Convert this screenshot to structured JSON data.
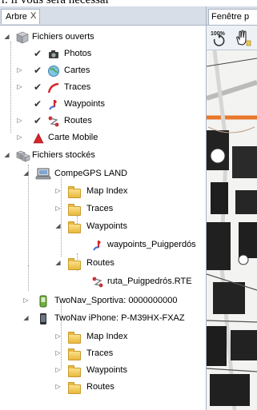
{
  "header_text": "r. il vous sera nécessai",
  "left_panel": {
    "tab_label": "Arbre",
    "tab_close": "X"
  },
  "tree": {
    "open_files": {
      "label": "Fichiers ouverts",
      "children": [
        {
          "label": "Photos",
          "icon": "camera-icon"
        },
        {
          "label": "Cartes",
          "icon": "globe-map-icon"
        },
        {
          "label": "Traces",
          "icon": "track-icon"
        },
        {
          "label": "Waypoints",
          "icon": "waypoint-icon"
        },
        {
          "label": "Routes",
          "icon": "route-icon"
        },
        {
          "label": "Carte Mobile",
          "icon": "red-triangle-icon"
        }
      ]
    },
    "stored_files": {
      "label": "Fichiers stockés",
      "compegps_land": {
        "label": "CompeGPS LAND",
        "map_index": "Map Index",
        "traces": "Traces",
        "waypoints": "Waypoints",
        "waypoints_file": "waypoints_Puigperdós",
        "routes": "Routes",
        "routes_file": "ruta_Puigpedrós.RTE"
      },
      "sportiva": {
        "label": "TwoNav_Sportiva: 0000000000"
      },
      "iphone": {
        "label": "TwoNav iPhone: P-M39HX-FXAZ",
        "map_index": "Map Index",
        "traces": "Traces",
        "waypoints": "Waypoints",
        "routes": "Routes"
      }
    }
  },
  "right_panel": {
    "tab_label": "Fenêtre p",
    "zoom_label": "100%"
  },
  "colors": {
    "accent_red": "#d6252b",
    "track_orange": "#e8782b",
    "folder_yellow": "#f2c94c"
  }
}
